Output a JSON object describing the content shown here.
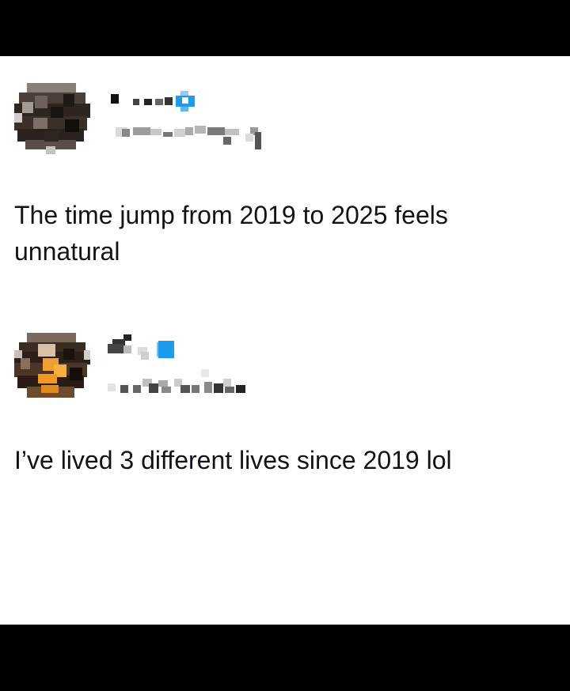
{
  "colors": {
    "background": "#ffffff",
    "letterbox": "#000000",
    "text": "#0f1419",
    "verified_badge": "#1d9bf0"
  },
  "posts": [
    {
      "avatar_icon": "pixelated-avatar-icon",
      "badge_icon": "verified-badge-icon",
      "text": "The time jump from 2019 to 2025 feels unnatural"
    },
    {
      "avatar_icon": "pixelated-avatar-icon",
      "badge_icon": "verified-badge-icon",
      "text": "I’ve lived 3 different lives since 2019 lol"
    }
  ]
}
